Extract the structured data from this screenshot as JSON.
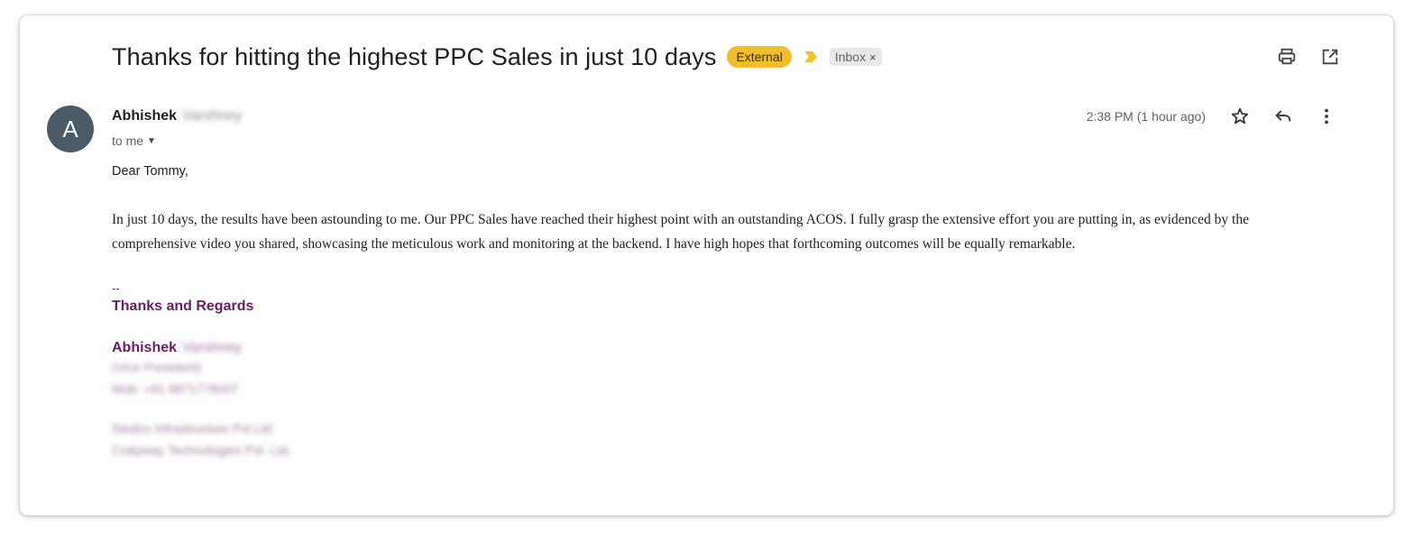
{
  "email": {
    "subject": "Thanks for hitting the highest PPC Sales in just 10 days",
    "external_badge": "External",
    "label": "Inbox",
    "label_remove": "×",
    "sender_first": "Abhishek",
    "sender_last_blurred": "Varshney",
    "avatar_letter": "A",
    "recipient": "to me",
    "timestamp": "2:38 PM (1 hour ago)",
    "greeting": "Dear Tommy,",
    "paragraph": "In just 10 days, the results have been astounding to me. Our PPC Sales have reached their highest point with an outstanding ACOS. I fully grasp the extensive effort you are putting in, as evidenced by the comprehensive video you shared, showcasing the meticulous work and monitoring at the backend. I have high hopes that forthcoming outcomes will be equally remarkable.",
    "signature_separator": "--",
    "regards": "Thanks and Regards",
    "sig_name": "Abhishek",
    "sig_name_blurred": "Varshney",
    "sig_line1_blurred": "(Vice President)",
    "sig_line2_blurred": "Mob: +91 9871776007",
    "sig_line3_blurred": "Stedco Infrastructure Pvt Ltd",
    "sig_line4_blurred": "Cratyway Technologies Pvt. Ltd."
  },
  "icons": {
    "print": "print-icon",
    "open_new_window": "open-in-new-window-icon",
    "star": "star-icon",
    "reply": "reply-icon",
    "more": "more-vertical-icon",
    "importance": "importance-marker-icon",
    "caret": "chevron-down-icon"
  },
  "colors": {
    "external_badge": "#f2bd2b",
    "importance_marker": "#f4c430",
    "signature": "#6a1b6a",
    "avatar": "#4a5a66"
  }
}
